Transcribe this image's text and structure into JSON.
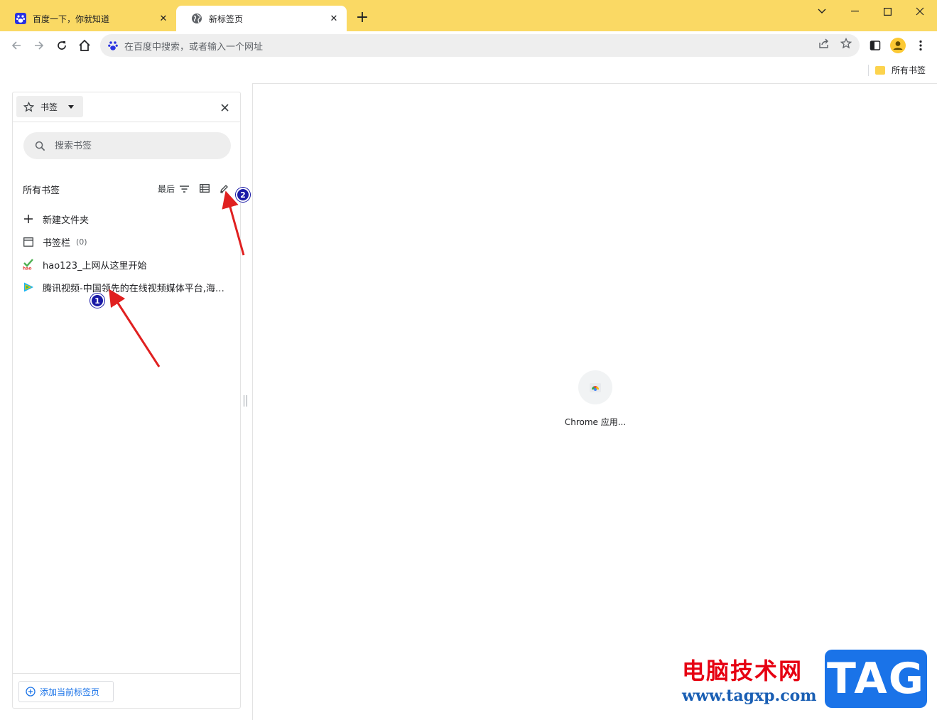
{
  "tabs": [
    {
      "title": "百度一下，你就知道",
      "icon": "baidu-paw-icon",
      "active": false
    },
    {
      "title": "新标签页",
      "icon": "globe-icon",
      "active": true
    }
  ],
  "toolbar": {
    "omnibox_placeholder": "在百度中搜索，或者输入一个网址"
  },
  "bookmarks_bar": {
    "folder_label": "所有书签"
  },
  "side_panel": {
    "title": "书签",
    "search_placeholder": "搜索书签",
    "section_title": "所有书签",
    "sort_label": "最后",
    "items": [
      {
        "label": "新建文件夹",
        "icon": "plus-icon"
      },
      {
        "label": "书签栏",
        "count": "(0)",
        "icon": "bookmarks-bar-folder-icon"
      },
      {
        "label": "hao123_上网从这里开始",
        "icon": "hao123-favicon"
      },
      {
        "label": "腾讯视频-中国领先的在线视频媒体平台,海量高清视频在线观看",
        "icon": "tencent-video-favicon"
      }
    ],
    "add_current_tab": "添加当前标签页"
  },
  "content": {
    "shortcut_label": "Chrome 应用..."
  },
  "annotations": [
    {
      "number": "1"
    },
    {
      "number": "2"
    }
  ],
  "watermark": {
    "title": "电脑技术网",
    "url": "www.tagxp.com",
    "logo": "TAG"
  },
  "colors": {
    "titlebar": "#fad964",
    "accent": "#1a73e8",
    "annotation_arrow": "#e02020",
    "annotation_badge": "#1a1aa6"
  }
}
